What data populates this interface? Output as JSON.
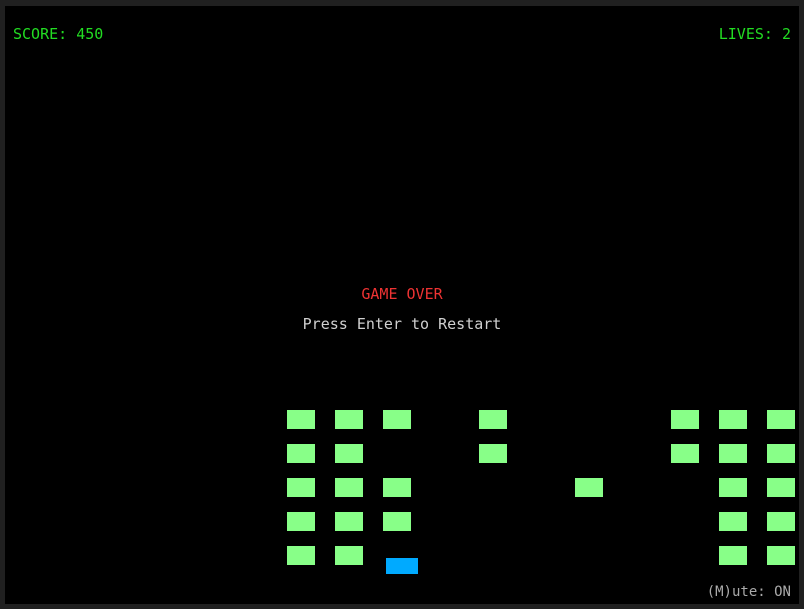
{
  "hud": {
    "score_label": "SCORE: 450",
    "lives_label": "LIVES: 2"
  },
  "messages": {
    "game_over": "GAME OVER",
    "restart_prompt": "Press Enter to Restart",
    "mute_status": "(M)ute: ON"
  },
  "colors": {
    "background": "#000000",
    "hud_text": "#22dd22",
    "game_over_text": "#ee3333",
    "brick": "#88ff88",
    "paddle": "#00aaff"
  },
  "bricks": {
    "columns": 11,
    "rows": 5,
    "grid": [
      [
        1,
        1,
        1,
        0,
        1,
        0,
        0,
        0,
        1,
        1,
        1
      ],
      [
        1,
        1,
        0,
        0,
        1,
        0,
        0,
        0,
        1,
        1,
        1
      ],
      [
        1,
        1,
        1,
        0,
        0,
        0,
        1,
        0,
        0,
        1,
        1
      ],
      [
        1,
        1,
        1,
        0,
        0,
        0,
        0,
        0,
        0,
        1,
        1
      ],
      [
        1,
        1,
        0,
        0,
        0,
        0,
        0,
        0,
        0,
        1,
        1
      ]
    ]
  }
}
